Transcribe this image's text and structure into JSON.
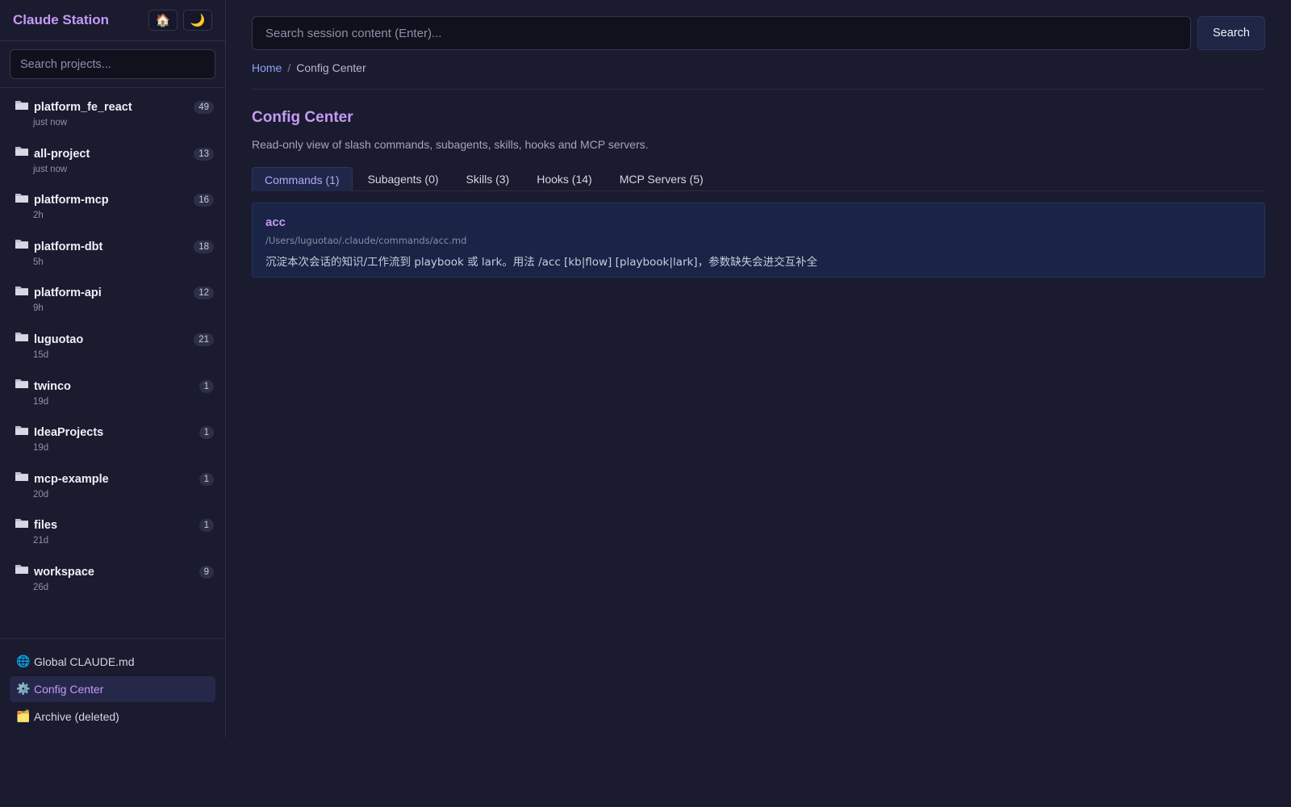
{
  "app": {
    "title": "Claude Station",
    "home_icon": "home-icon",
    "theme_icon": "moon-icon"
  },
  "sidebar": {
    "search_placeholder": "Search projects...",
    "projects": [
      {
        "name": "platform_fe_react",
        "count": "49",
        "time": "just now"
      },
      {
        "name": "all-project",
        "count": "13",
        "time": "just now"
      },
      {
        "name": "platform-mcp",
        "count": "16",
        "time": "2h"
      },
      {
        "name": "platform-dbt",
        "count": "18",
        "time": "5h"
      },
      {
        "name": "platform-api",
        "count": "12",
        "time": "9h"
      },
      {
        "name": "luguotao",
        "count": "21",
        "time": "15d"
      },
      {
        "name": "twinco",
        "count": "1",
        "time": "19d"
      },
      {
        "name": "IdeaProjects",
        "count": "1",
        "time": "19d"
      },
      {
        "name": "mcp-example",
        "count": "1",
        "time": "20d"
      },
      {
        "name": "files",
        "count": "1",
        "time": "21d"
      },
      {
        "name": "workspace",
        "count": "9",
        "time": "26d"
      }
    ],
    "footer": [
      {
        "label": "Global CLAUDE.md",
        "icon": "globe-icon"
      },
      {
        "label": "Config Center",
        "icon": "gear-icon",
        "active": true
      },
      {
        "label": "Archive (deleted)",
        "icon": "file-cabinet-icon"
      }
    ]
  },
  "main": {
    "search_placeholder": "Search session content (Enter)...",
    "search_button": "Search",
    "breadcrumb": {
      "home": "Home",
      "separator": "/",
      "current": "Config Center"
    },
    "title": "Config Center",
    "description": "Read-only view of slash commands, subagents, skills, hooks and MCP servers.",
    "tabs": [
      {
        "label": "Commands (1)",
        "active": true
      },
      {
        "label": "Subagents (0)"
      },
      {
        "label": "Skills (3)"
      },
      {
        "label": "Hooks (14)"
      },
      {
        "label": "MCP Servers (5)"
      }
    ],
    "commands": [
      {
        "name": "acc",
        "path": "/Users/luguotao/.claude/commands/acc.md",
        "description": "沉淀本次会话的知识/工作流到 playbook 或 lark。用法 /acc [kb|flow] [playbook|lark]，参数缺失会进交互补全"
      }
    ]
  },
  "colors": {
    "background": "#1a1b2e",
    "accent": "#c49af5",
    "link": "#8aa4f5",
    "card": "#192446"
  }
}
